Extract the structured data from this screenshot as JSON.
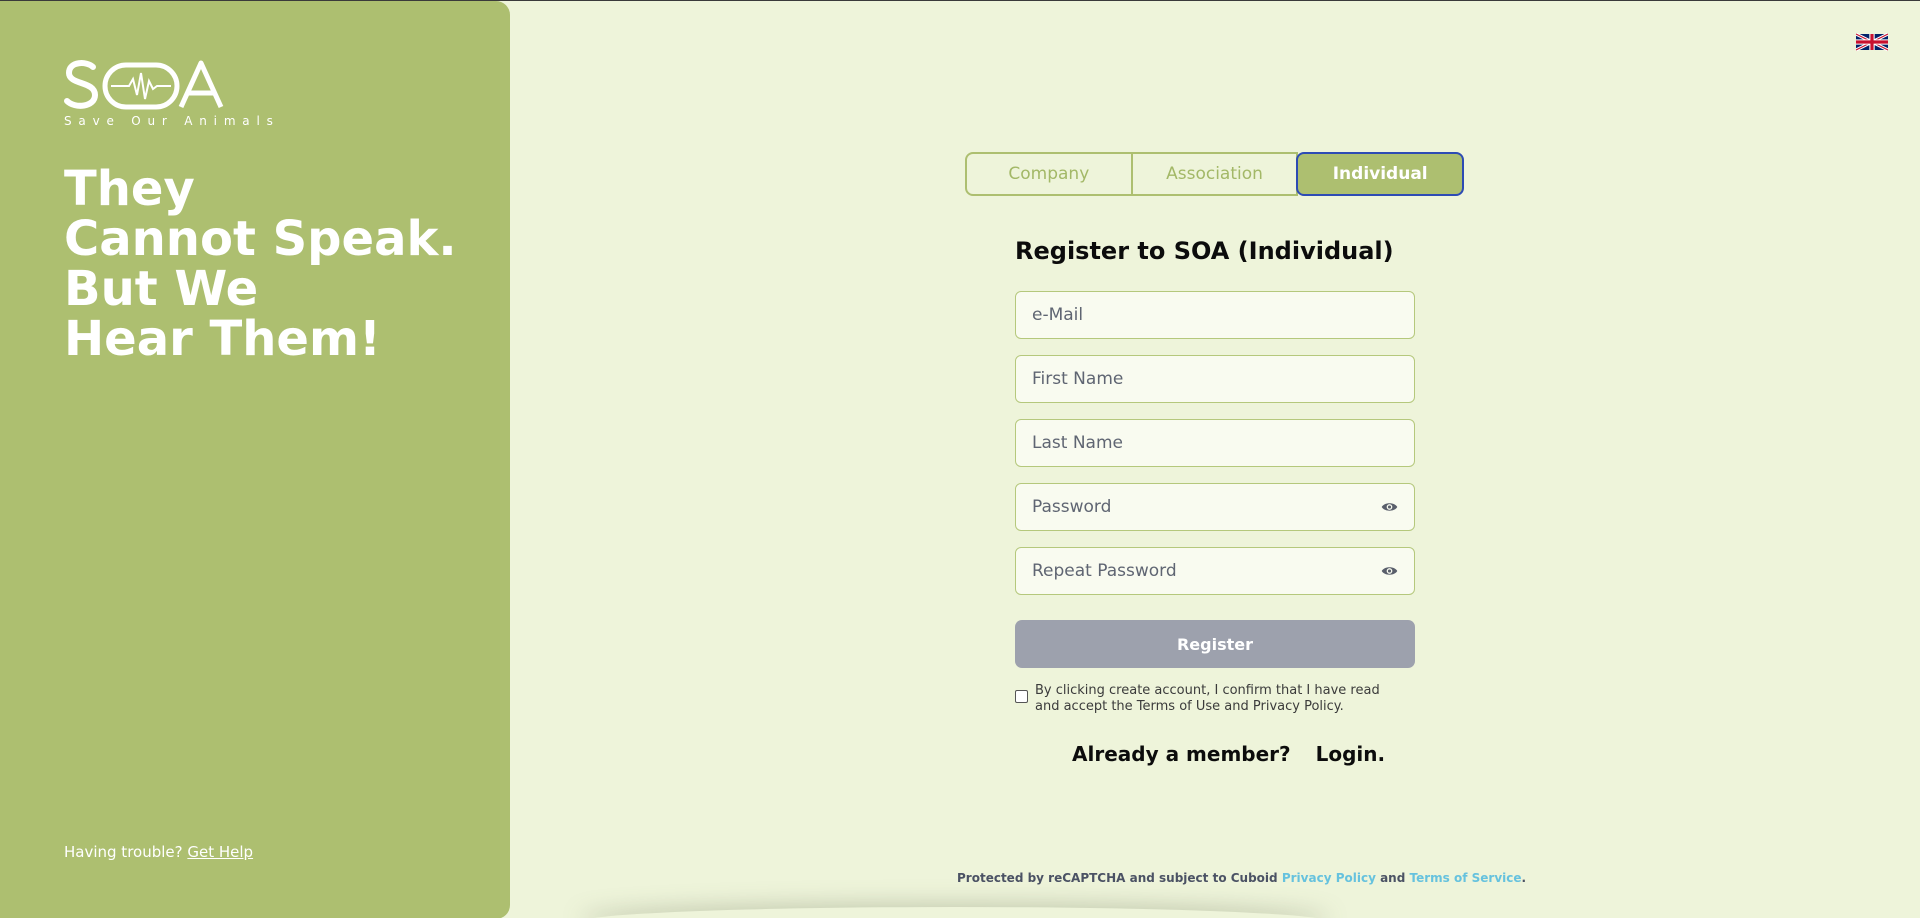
{
  "brand": {
    "logo_text": "SOA",
    "tagline": "Save Our Animals",
    "headline_lines": [
      "They",
      "Cannot Speak.",
      "But We",
      "Hear Them!"
    ]
  },
  "help": {
    "prefix": "Having trouble?",
    "link": "Get Help"
  },
  "language": {
    "flag": "uk-flag-icon"
  },
  "tabs": [
    {
      "label": "Company",
      "active": false
    },
    {
      "label": "Association",
      "active": false
    },
    {
      "label": "Individual",
      "active": true
    }
  ],
  "form": {
    "title": "Register to SOA (Individual)",
    "fields": {
      "email": {
        "placeholder": "e-Mail",
        "value": ""
      },
      "first_name": {
        "placeholder": "First Name",
        "value": ""
      },
      "last_name": {
        "placeholder": "Last Name",
        "value": ""
      },
      "password": {
        "placeholder": "Password",
        "value": ""
      },
      "repeat_password": {
        "placeholder": "Repeat Password",
        "value": ""
      }
    },
    "register_label": "Register",
    "terms_text": "By clicking create account, I confirm that I have read and accept the Terms of Use and Privacy Policy.",
    "member_text": "Already a member?",
    "login_text": "Login."
  },
  "recaptcha": {
    "prefix": "Protected by reCAPTCHA and subject to Cuboid",
    "privacy": "Privacy Policy",
    "and": "and",
    "terms": "Terms of Service",
    "suffix": "."
  },
  "colors": {
    "panel": "#adbf70",
    "background": "#eef4da",
    "register_disabled": "#9da1ad",
    "link": "#66c2de",
    "active_tab_border": "#2d4bb4"
  }
}
